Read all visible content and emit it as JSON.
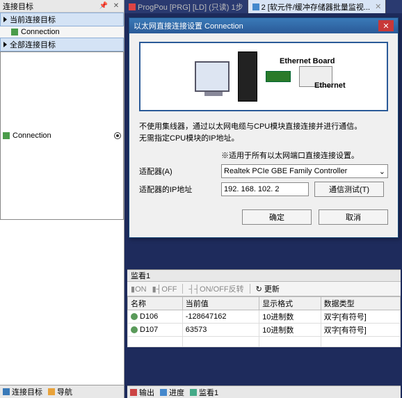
{
  "left_panel": {
    "title": "连接目标",
    "sections": [
      {
        "title": "当前连接目标",
        "items": [
          {
            "label": "Connection",
            "selected": false
          }
        ]
      },
      {
        "title": "全部连接目标",
        "items": [
          {
            "label": "Connection",
            "selected": true
          }
        ]
      }
    ],
    "footer": [
      {
        "icon": "sq-blue",
        "label": "连接目标"
      },
      {
        "icon": "sq-or",
        "label": "导航"
      }
    ]
  },
  "tabs": [
    {
      "label": "ProgPou [PRG] [LD] (只读) 1步",
      "active": false
    },
    {
      "label": "2 [软元件/缓冲存储器批量监视...",
      "active": true
    }
  ],
  "dialog": {
    "title": "以太网直接连接设置 Connection",
    "diagram": {
      "eth_board": "Ethernet Board",
      "eth": "Ethernet"
    },
    "desc_l1": "不使用集线器，通过以太网电缆与CPU模块直接连接并进行通信。",
    "desc_l2": "无需指定CPU模块的IP地址。",
    "note": "※适用于所有以太网端口直接连接设置。",
    "adapter_label": "适配器(A)",
    "adapter_value": "Realtek PCIe GBE Family Controller",
    "ip_label": "适配器的IP地址",
    "ip_value": "192. 168. 102. 2",
    "test_btn": "通信测试(T)",
    "ok_btn": "确定",
    "cancel_btn": "取消"
  },
  "watch": {
    "title": "监看1",
    "toolbar": {
      "on": "ON",
      "off": "OFF",
      "toggle": "ON/OFF反转",
      "update": "更新"
    },
    "columns": [
      "名称",
      "当前值",
      "显示格式",
      "数据类型"
    ],
    "rows": [
      {
        "name": "D106",
        "value": "-128647162",
        "fmt": "10进制数",
        "type": "双字[有符号]"
      },
      {
        "name": "D107",
        "value": "63573",
        "fmt": "10进制数",
        "type": "双字[有符号]"
      }
    ]
  },
  "status": {
    "items": [
      {
        "label": "输出"
      },
      {
        "label": "进度"
      },
      {
        "label": "监看1"
      }
    ]
  }
}
